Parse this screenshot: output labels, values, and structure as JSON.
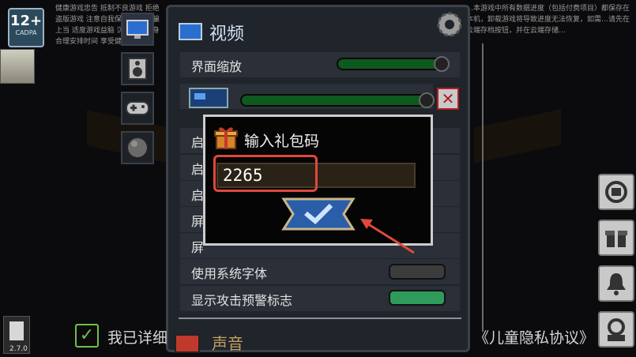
{
  "age_rating": {
    "number": "12+",
    "sub": "CADPA"
  },
  "notice_left": "健康游戏忠告 抵制不良游戏 拒绝盗版游戏 注意自我保护 谨防受骗上当 适度游戏益脑 沉迷游戏伤身 合理安排时间 享受健康生活",
  "notice_right": "…本游戏中所有数据进度（包括付费项目）都保存在本机，卸载游戏将导致进度无法恢复，如需…请先在云端存档按钮，并在云端存储…",
  "version": "2.7.0",
  "panel": {
    "title": "视频"
  },
  "settings": {
    "ui_scale_label": "界面缩放",
    "row_a": "启",
    "row_b": "启",
    "row_c": "启",
    "row_d": "屏",
    "row_e": "屏",
    "system_font_label": "使用系统字体",
    "attack_warning_label": "显示攻击预警标志"
  },
  "bottom_tab_label": "声音",
  "agreement": {
    "prefix": "我已详细",
    "suffix": "《儿童隐私协议》"
  },
  "gift_dialog": {
    "title": "输入礼包码",
    "code_value": "2265"
  },
  "colors": {
    "highlight": "#e0483a",
    "slider_green": "#0e5a1e",
    "toggle_on": "#2e9b5a"
  },
  "icons": [
    "monitor-icon",
    "speaker-icon",
    "gamepad-icon",
    "ball-icon",
    "gear-icon",
    "close-icon",
    "gift-icon",
    "check-icon",
    "sync-icon",
    "bell-icon",
    "support-icon"
  ]
}
